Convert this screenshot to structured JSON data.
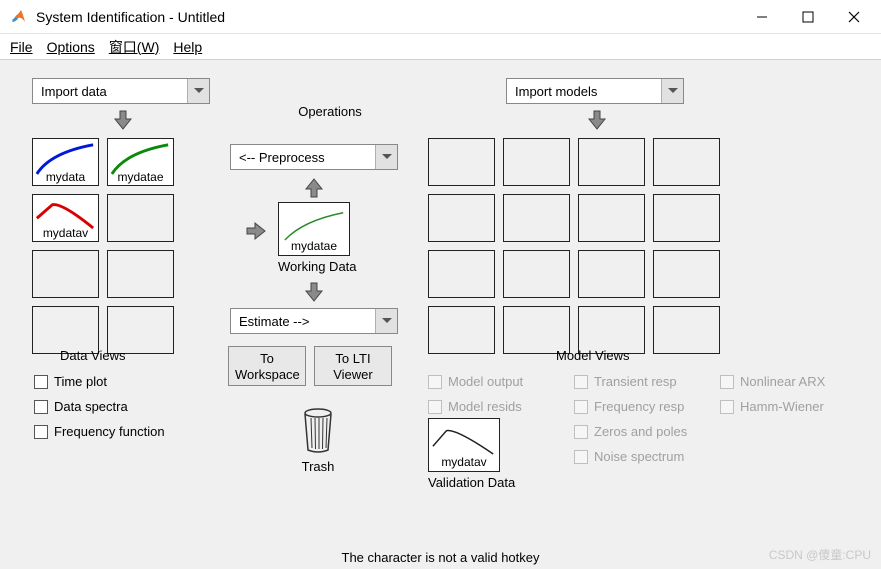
{
  "window": {
    "title": "System Identification - Untitled",
    "min_tip": "Minimize",
    "max_tip": "Maximize",
    "close_tip": "Close"
  },
  "menu": {
    "file": "File",
    "options": "Options",
    "window": "窗口(W)",
    "help": "Help"
  },
  "dropdowns": {
    "import_data": "Import data",
    "import_models": "Import models",
    "preprocess": "<-- Preprocess",
    "estimate": "Estimate -->"
  },
  "labels": {
    "operations": "Operations",
    "working_data": "Working Data",
    "data_views": "Data Views",
    "model_views": "Model Views",
    "validation_data": "Validation Data",
    "trash": "Trash",
    "status": "The character   is not a valid hotkey"
  },
  "buttons": {
    "to_workspace": "To Workspace",
    "to_lti": "To LTI Viewer"
  },
  "data_slots": {
    "s1": "mydata",
    "s2": "mydatae",
    "s3": "mydatav"
  },
  "working_slot": "mydatae",
  "validation_slot": "mydatav",
  "data_view_checks": {
    "time_plot": "Time plot",
    "data_spectra": "Data spectra",
    "freq_func": "Frequency function"
  },
  "model_view_checks": {
    "model_output": "Model output",
    "model_resids": "Model resids",
    "transient": "Transient resp",
    "frequency": "Frequency resp",
    "zeros": "Zeros and poles",
    "noise": "Noise spectrum",
    "nonlinear": "Nonlinear ARX",
    "hamm": "Hamm-Wiener"
  },
  "watermark": "CSDN @傻童:CPU"
}
